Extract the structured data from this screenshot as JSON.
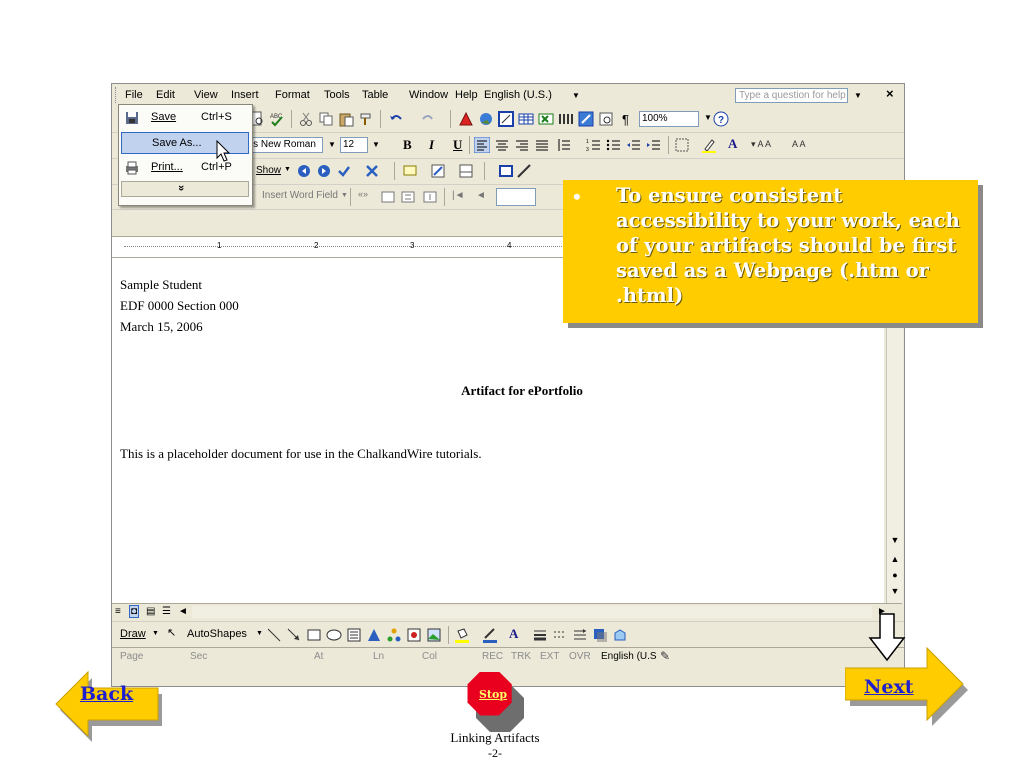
{
  "menubar": {
    "items": [
      "File",
      "Edit",
      "View",
      "Insert",
      "Format",
      "Tools",
      "Table",
      "Window",
      "Help"
    ],
    "language": "English (U.S.)",
    "question_placeholder": "Type a question for help",
    "close": "×"
  },
  "file_menu": {
    "items": [
      {
        "label": "Save",
        "shortcut": "Ctrl+S"
      },
      {
        "label": "Save As...",
        "shortcut": ""
      },
      {
        "label": "Print...",
        "shortcut": "Ctrl+P"
      }
    ],
    "expand": "»"
  },
  "toolbar": {
    "zoom": "100%",
    "font": "nes New Roman",
    "size": "12",
    "bold": "B",
    "italic": "I",
    "underline": "U",
    "show": "Show",
    "insert_field": "Insert Word Field",
    "font_a": "A"
  },
  "ruler": {
    "marks": [
      "1",
      "2",
      "3",
      "4"
    ]
  },
  "document": {
    "author": "Sample Student",
    "course": "EDF 0000 Section 000",
    "date": "March 15, 2006",
    "title": "Artifact for ePortfolio",
    "body": "This is a placeholder document for use in the ChalkandWire tutorials."
  },
  "drawbar": {
    "draw": "Draw",
    "autoshapes": "AutoShapes"
  },
  "statusbar": {
    "page": "Page",
    "sec": "Sec",
    "at": "At",
    "ln": "Ln",
    "col": "Col",
    "rec": "REC",
    "trk": "TRK",
    "ext": "EXT",
    "ovr": "OVR",
    "language": "English (U.S"
  },
  "callout": {
    "bullet": "•",
    "text": "To ensure consistent accessibility to your work, each of your artifacts should be first saved as a Webpage (.htm or .html)"
  },
  "nav": {
    "back": "Back",
    "next": "Next",
    "stop": "Stop"
  },
  "footer": {
    "title": "Linking Artifacts",
    "page": "-2-"
  },
  "colors": {
    "callout": "#ffcc00",
    "arrow": "#ffcc00",
    "stop": "#e8001e",
    "link": "#1f1fcf"
  }
}
